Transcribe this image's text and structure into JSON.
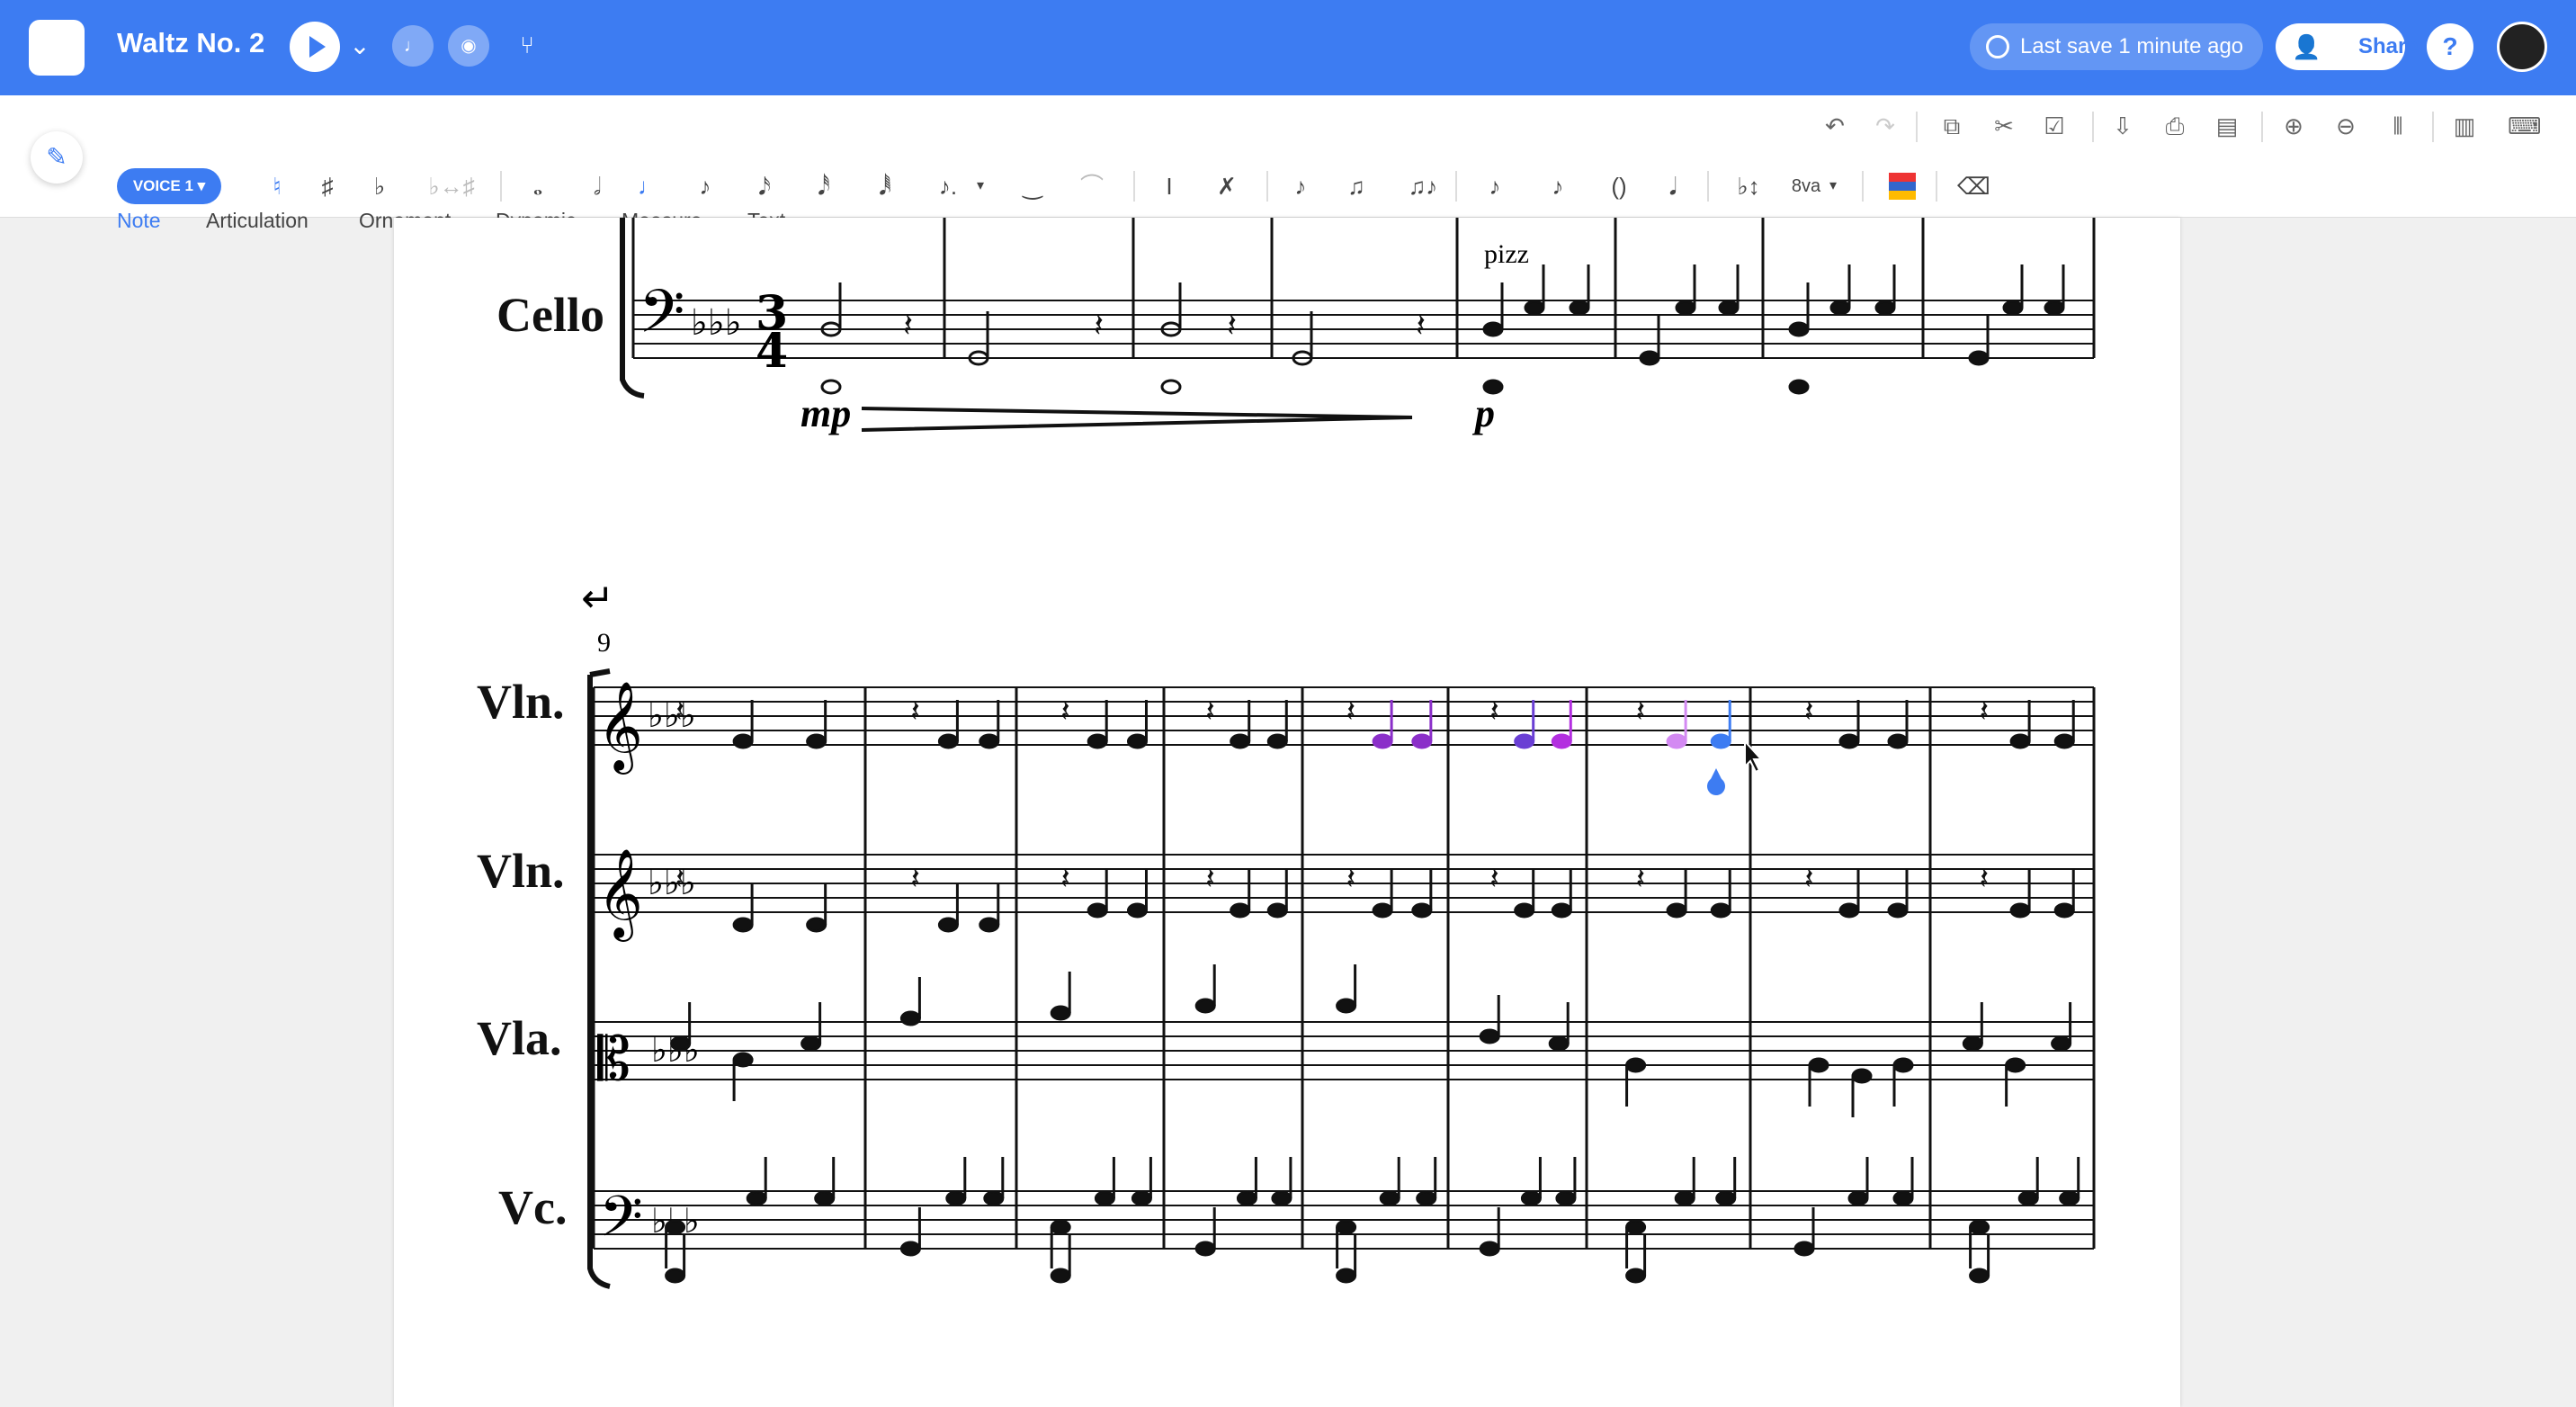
{
  "app": {
    "title": "Waltz No. 2",
    "last_save": "Last save 1 minute ago",
    "share_label": "Share",
    "help_label": "?"
  },
  "icons": {
    "play": "play-icon",
    "chevron": "chevron-down-icon",
    "metronome": "metronome-icon",
    "speaker": "speaker-icon",
    "tuner": "tuning-fork-icon"
  },
  "tabs": [
    {
      "label": "Note"
    },
    {
      "label": "Articulation"
    },
    {
      "label": "Ornament"
    },
    {
      "label": "Dynamic"
    },
    {
      "label": "Measure"
    },
    {
      "label": "Text"
    }
  ],
  "voice_button": "VOICE 1 ▾",
  "colors": {
    "accent": "#3d7cf2",
    "selected_purple": "#8b2fc9",
    "selected_blue": "#3d7cf2"
  },
  "score": {
    "system1": {
      "instrument": "Cello",
      "text_marking": "pizz",
      "dynamics": [
        "mp",
        "p"
      ]
    },
    "system2": {
      "measure_number": "9",
      "instruments": [
        "Vln.",
        "Vln.",
        "Vla.",
        "Vc."
      ]
    }
  }
}
